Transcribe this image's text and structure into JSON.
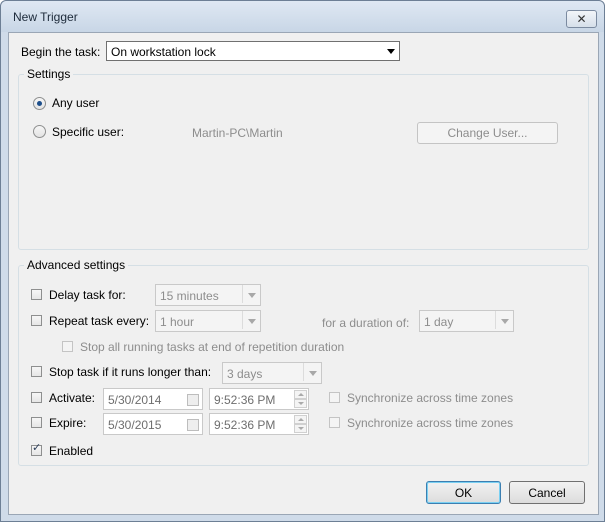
{
  "window": {
    "title": "New Trigger",
    "close_glyph": "✕"
  },
  "begin_task": {
    "label": "Begin the task:",
    "value": "On workstation lock"
  },
  "settings": {
    "group_title": "Settings",
    "any_user_label": "Any user",
    "any_user_selected": true,
    "specific_user_label": "Specific user:",
    "specific_user_selected": false,
    "user_name": "Martin-PC\\Martin",
    "change_user_button": "Change User..."
  },
  "advanced": {
    "group_title": "Advanced settings",
    "delay": {
      "label": "Delay task for:",
      "checked": false,
      "value": "15 minutes"
    },
    "repeat": {
      "label": "Repeat task every:",
      "checked": false,
      "value": "1 hour",
      "duration_label": "for a duration of:",
      "duration_value": "1 day"
    },
    "stop_running": {
      "label": "Stop all running tasks at end of repetition duration",
      "checked": false
    },
    "stop_longer": {
      "label": "Stop task if it runs longer than:",
      "checked": false,
      "value": "3 days"
    },
    "activate": {
      "label": "Activate:",
      "checked": false,
      "date": "5/30/2014",
      "time": "9:52:36 PM",
      "sync_label": "Synchronize across time zones",
      "sync_checked": false
    },
    "expire": {
      "label": "Expire:",
      "checked": false,
      "date": "5/30/2015",
      "time": "9:52:36 PM",
      "sync_label": "Synchronize across time zones",
      "sync_checked": false
    },
    "enabled": {
      "label": "Enabled",
      "checked": true,
      "tick": "✓"
    }
  },
  "buttons": {
    "ok": "OK",
    "cancel": "Cancel"
  }
}
